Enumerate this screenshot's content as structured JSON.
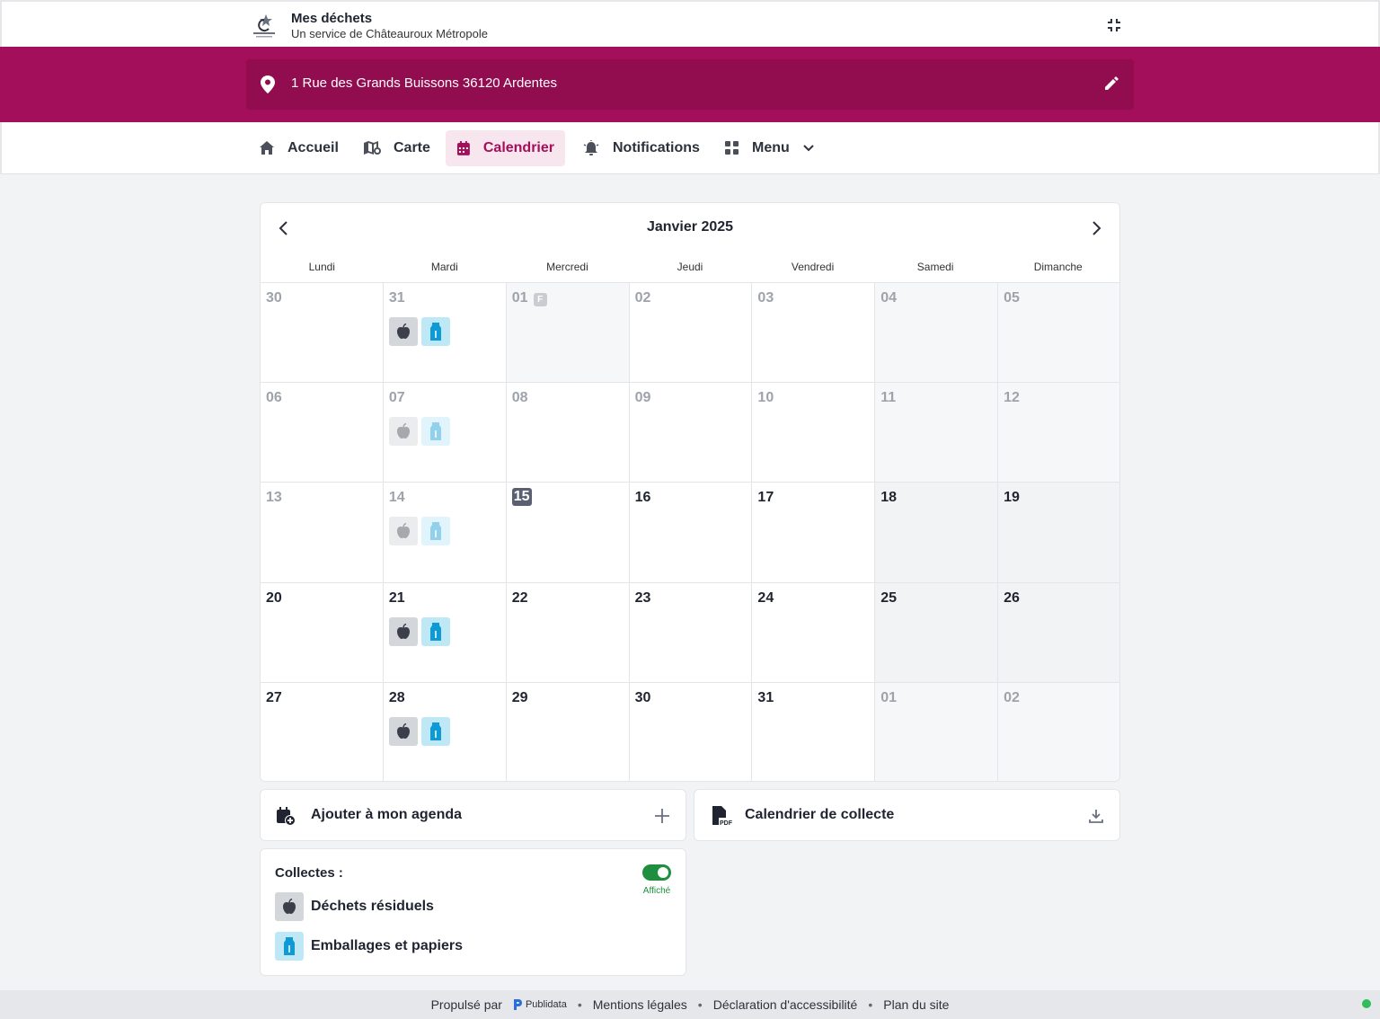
{
  "header": {
    "title": "Mes déchets",
    "subtitle": "Un service de Châteauroux Métropole",
    "logo_icon": "chateauroux-logo-icon",
    "collapse_icon": "collapse-icon"
  },
  "address": {
    "text": "1 Rue des Grands Buissons 36120 Ardentes",
    "icon": "map-pin-icon",
    "edit_icon": "pencil-icon"
  },
  "nav": {
    "items": [
      {
        "label": "Accueil",
        "icon": "home-icon"
      },
      {
        "label": "Carte",
        "icon": "map-icon"
      },
      {
        "label": "Calendrier",
        "icon": "calendar-icon",
        "active": true
      },
      {
        "label": "Notifications",
        "icon": "bell-icon"
      },
      {
        "label": "Menu",
        "icon": "grid-icon"
      }
    ]
  },
  "calendar": {
    "title": "Janvier 2025",
    "weekdays": [
      "Lundi",
      "Mardi",
      "Mercredi",
      "Jeudi",
      "Vendredi",
      "Samedi",
      "Dimanche"
    ],
    "holiday_badge": "F",
    "weeks": [
      [
        {
          "day": "30",
          "state": "out"
        },
        {
          "day": "31",
          "state": "out",
          "collections": [
            "residual",
            "packaging"
          ]
        },
        {
          "day": "01",
          "state": "past",
          "holiday": true
        },
        {
          "day": "02",
          "state": "past"
        },
        {
          "day": "03",
          "state": "past"
        },
        {
          "day": "04",
          "state": "past",
          "weekend": true
        },
        {
          "day": "05",
          "state": "past",
          "weekend": true
        }
      ],
      [
        {
          "day": "06",
          "state": "past"
        },
        {
          "day": "07",
          "state": "past",
          "collections": [
            "residual",
            "packaging"
          ]
        },
        {
          "day": "08",
          "state": "past"
        },
        {
          "day": "09",
          "state": "past"
        },
        {
          "day": "10",
          "state": "past"
        },
        {
          "day": "11",
          "state": "past",
          "weekend": true
        },
        {
          "day": "12",
          "state": "past",
          "weekend": true
        }
      ],
      [
        {
          "day": "13",
          "state": "past"
        },
        {
          "day": "14",
          "state": "past",
          "collections": [
            "residual",
            "packaging"
          ]
        },
        {
          "day": "15",
          "state": "today"
        },
        {
          "day": "16",
          "state": "current"
        },
        {
          "day": "17",
          "state": "current"
        },
        {
          "day": "18",
          "state": "current",
          "weekend": true
        },
        {
          "day": "19",
          "state": "current",
          "weekend": true
        }
      ],
      [
        {
          "day": "20",
          "state": "current"
        },
        {
          "day": "21",
          "state": "current",
          "collections": [
            "residual",
            "packaging"
          ]
        },
        {
          "day": "22",
          "state": "current"
        },
        {
          "day": "23",
          "state": "current"
        },
        {
          "day": "24",
          "state": "current"
        },
        {
          "day": "25",
          "state": "current",
          "weekend": true
        },
        {
          "day": "26",
          "state": "current",
          "weekend": true
        }
      ],
      [
        {
          "day": "27",
          "state": "current"
        },
        {
          "day": "28",
          "state": "current",
          "collections": [
            "residual",
            "packaging"
          ]
        },
        {
          "day": "29",
          "state": "current"
        },
        {
          "day": "30",
          "state": "current"
        },
        {
          "day": "31",
          "state": "current"
        },
        {
          "day": "01",
          "state": "out",
          "weekend": true
        },
        {
          "day": "02",
          "state": "out",
          "weekend": true
        }
      ]
    ]
  },
  "actions": {
    "add_agenda": {
      "label": "Ajouter à mon agenda",
      "icon": "calendar-add-icon",
      "right_icon": "plus-icon"
    },
    "pdf": {
      "label": "Calendrier de collecte",
      "icon": "pdf-file-icon",
      "right_icon": "download-icon"
    }
  },
  "legend": {
    "title": "Collectes :",
    "toggle_label": "Affiché",
    "toggle_on": true,
    "items": [
      {
        "type": "residual",
        "label": "Déchets résiduels",
        "icon": "apple-icon",
        "bg": "#d3d6da",
        "fg": "#3a3f4a"
      },
      {
        "type": "packaging",
        "label": "Emballages et papiers",
        "icon": "carton-icon",
        "bg": "#bfe8f7",
        "fg": "#0f9ad6"
      }
    ]
  },
  "footer": {
    "powered": "Propulsé par",
    "brand": "Publidata",
    "links": [
      "Mentions légales",
      "Déclaration d'accessibilité",
      "Plan du site"
    ]
  },
  "colors": {
    "brand": "#a30f5b",
    "brand_dark": "#920c50",
    "active_bg": "#f8e6ee",
    "toggle_on": "#1f8f3f"
  }
}
